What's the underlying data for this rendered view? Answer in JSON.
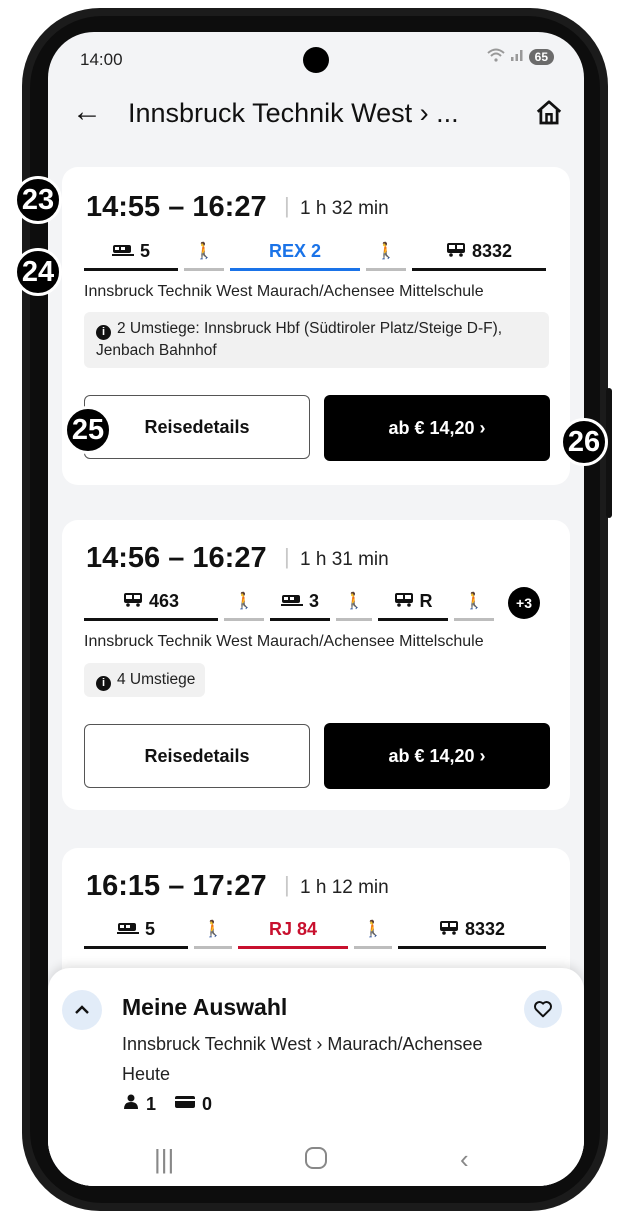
{
  "status": {
    "time": "14:00",
    "battery": "65"
  },
  "header": {
    "title": "Innsbruck Technik West › ..."
  },
  "connections": [
    {
      "depart": "14:55",
      "arrive": "16:27",
      "duration": "1 h 32 min",
      "legs": [
        "5",
        "REX 2",
        "8332"
      ],
      "stops": "Innsbruck Technik West Maurach/Achensee Mittelschule",
      "info": "2 Umstiege: Innsbruck Hbf (Südtiroler Platz/Steige D-F), Jenbach Bahnhof",
      "details_label": "Reisedetails",
      "price_label": "ab € 14,20 ›"
    },
    {
      "depart": "14:56",
      "arrive": "16:27",
      "duration": "1 h 31 min",
      "legs": [
        "463",
        "3",
        "R"
      ],
      "more": "+3",
      "stops": "Innsbruck Technik West Maurach/Achensee Mittelschule",
      "info": "4 Umstiege",
      "details_label": "Reisedetails",
      "price_label": "ab € 14,20 ›"
    },
    {
      "depart": "16:15",
      "arrive": "17:27",
      "duration": "1 h 12 min",
      "legs": [
        "5",
        "RJ 84",
        "8332"
      ]
    }
  ],
  "sheet": {
    "title": "Meine Auswahl",
    "route": "Innsbruck Technik West › Maurach/Achensee",
    "date": "Heute",
    "passengers": "1",
    "cards": "0"
  },
  "markers": [
    "23",
    "24",
    "25",
    "26"
  ],
  "colors": {
    "rex": "#1a73e8",
    "rj": "#c8102e",
    "walk_bar": "#bdbdbd",
    "dark": "#000000"
  }
}
